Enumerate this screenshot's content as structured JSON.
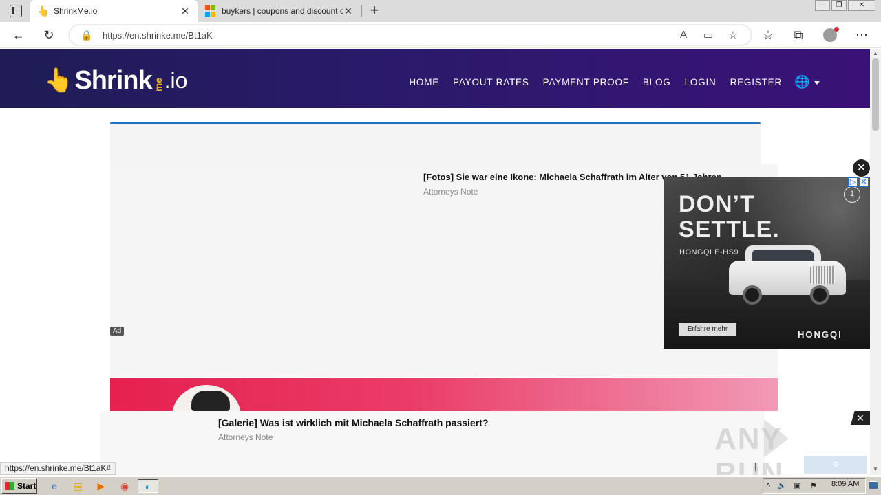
{
  "browser": {
    "tabs": [
      {
        "title": "ShrinkMe.io",
        "active": true,
        "close": "✕"
      },
      {
        "title": "buykers | coupons and discount c",
        "active": false,
        "close": "✕"
      }
    ],
    "new_tab": "+",
    "url": "https://en.shrinke.me/Bt1aK",
    "status_url": "https://en.shrinke.me/Bt1aK#"
  },
  "site": {
    "logo": {
      "word": "Shrink",
      "me": "me",
      "io": ".io"
    },
    "nav": [
      "HOME",
      "PAYOUT RATES",
      "PAYMENT PROOF",
      "BLOG",
      "LOGIN",
      "REGISTER"
    ]
  },
  "ad_top": {
    "headline": "[Fotos] Sie war eine Ikone: Michaela Schaffrath im Alter von 51 Jahren",
    "source": "Attorneys Note",
    "tag": "Ad"
  },
  "video_ad": {
    "headline_1": "DON’T",
    "headline_2": "SETTLE.",
    "model": "HONGQI E-HS9",
    "cta": "Erfahre mehr",
    "brand": "HONGQI",
    "counter": "1"
  },
  "ad_bottom": {
    "headline": "[Galerie] Was ist wirklich mit Michaela Schaffrath passiert?",
    "source": "Attorneys Note"
  },
  "watermark": {
    "left": "ANY",
    "right": "RUN"
  },
  "taskbar": {
    "start": "Start",
    "clock": "8:09 AM"
  },
  "colors": {
    "header_start": "#1f1c56",
    "header_end": "#3a1277",
    "accent_blue": "#1f6fc4",
    "logo_gold": "#f5b21b",
    "banner_pink": "#e5204f"
  }
}
